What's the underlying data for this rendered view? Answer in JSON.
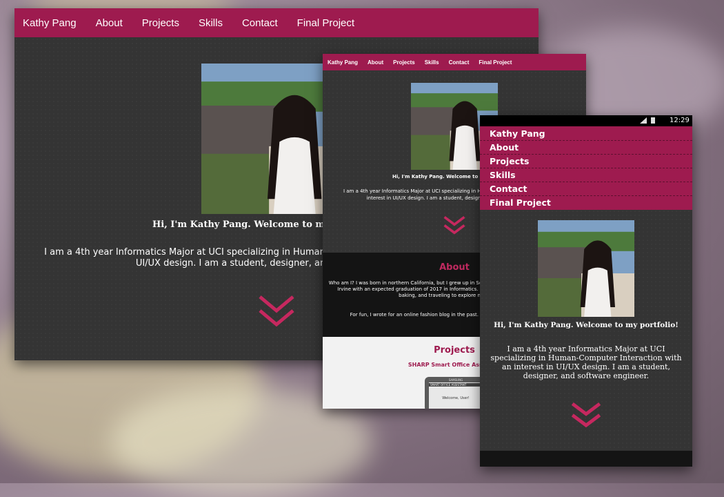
{
  "nav_items": [
    "Kathy Pang",
    "About",
    "Projects",
    "Skills",
    "Contact",
    "Final Project"
  ],
  "hero": {
    "welcome": "Hi, I'm Kathy Pang. Welcome to my portfolio!",
    "bio": "I am a 4th year Informatics Major at UCI specializing in Human-Computer Interaction with an interest in UI/UX design. I am a student, designer, and software engineer."
  },
  "about": {
    "heading": "About",
    "p1": "Who am I? I was born in northern California, but I grew up in Southern California. I currently attend UC Irvine with an expected graduation of 2017 in Informatics. Outside of school, I enjoy designing, baking, and traveling to explore new places.",
    "p2": "For fun, I wrote for an online fashion blog in the past. Here you can view my articles."
  },
  "projects": {
    "heading": "Projects",
    "item": "SHARP Smart Office Assistant",
    "device_brand": "SAMSUNG",
    "device_title": "SMART OFFICE ASSISTANT",
    "device_welcome": "Welcome, User!"
  },
  "status": {
    "time": "12:29"
  },
  "colors": {
    "accent": "#9e1b4f",
    "chevron": "#c6285f",
    "dark_bg": "#343434"
  }
}
